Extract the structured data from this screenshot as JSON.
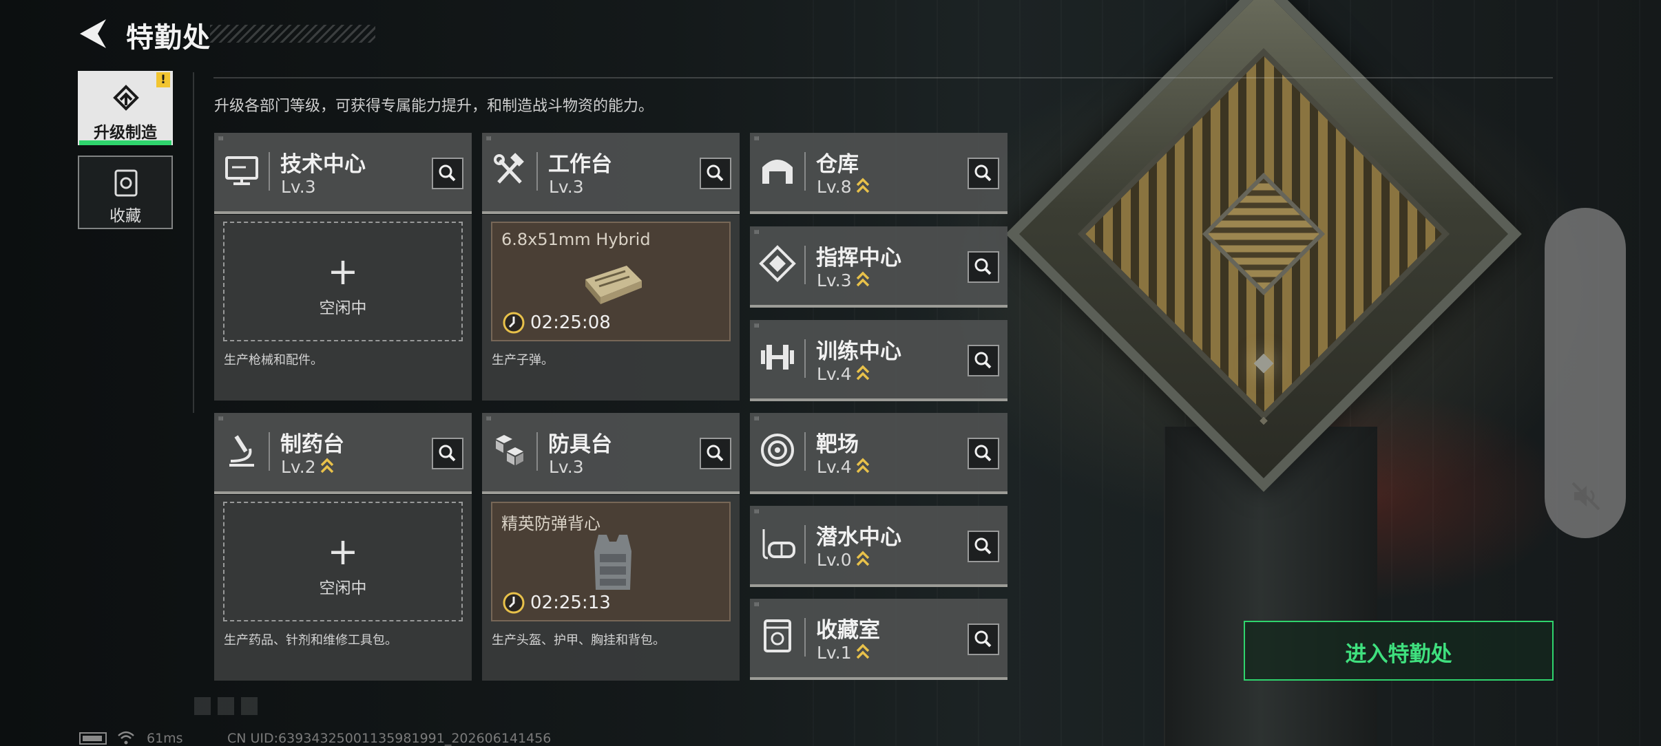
{
  "header": {
    "title": "特勤处",
    "subtitle": "升级各部门等级，可获得专属能力提升，和制造战斗物资的能力。"
  },
  "tabs": [
    {
      "label": "升级制造",
      "active": true,
      "alert": "!"
    },
    {
      "label": "收藏",
      "active": false
    }
  ],
  "departments": {
    "tech": {
      "name": "技术中心",
      "level": "Lv.3",
      "icon": "monitor-icon",
      "slot_plus": "+",
      "slot_status": "空闲中",
      "desc": "生产枪械和配件。"
    },
    "workbench": {
      "name": "工作台",
      "level": "Lv.3",
      "icon": "hammer-wrench-icon",
      "product": "6.8x51mm Hybrid",
      "timer": "02:25:08",
      "desc": "生产子弹。"
    },
    "pharmacy": {
      "name": "制药台",
      "level": "Lv.2",
      "icon": "microscope-icon",
      "upgradable": true,
      "slot_plus": "+",
      "slot_status": "空闲中",
      "desc": "生产药品、针剂和维修工具包。"
    },
    "armor": {
      "name": "防具台",
      "level": "Lv.3",
      "icon": "cubes-icon",
      "product": "精英防弹背心",
      "timer": "02:25:13",
      "desc": "生产头盔、护甲、胸挂和背包。"
    },
    "warehouse": {
      "name": "仓库",
      "level": "Lv.8",
      "icon": "warehouse-icon",
      "upgradable": true
    },
    "command": {
      "name": "指挥中心",
      "level": "Lv.3",
      "icon": "command-diamond-icon",
      "upgradable": true
    },
    "training": {
      "name": "训练中心",
      "level": "Lv.4",
      "icon": "dumbbell-icon",
      "upgradable": true
    },
    "range": {
      "name": "靶场",
      "level": "Lv.4",
      "icon": "target-icon",
      "upgradable": true
    },
    "diving": {
      "name": "潜水中心",
      "level": "Lv.0",
      "icon": "diving-mask-icon",
      "upgradable": true
    },
    "collection": {
      "name": "收藏室",
      "level": "Lv.1",
      "icon": "trophy-room-icon",
      "upgradable": true
    }
  },
  "enter_button": {
    "label": "进入特勤处"
  },
  "footer": {
    "ping": "61ms",
    "uid": "CN UID:6393432500113598199​1_202606141456"
  },
  "colors": {
    "accent_green": "#2fd46d",
    "upgrade_gold": "#e8c14a",
    "alert_yellow": "#f2c530"
  }
}
